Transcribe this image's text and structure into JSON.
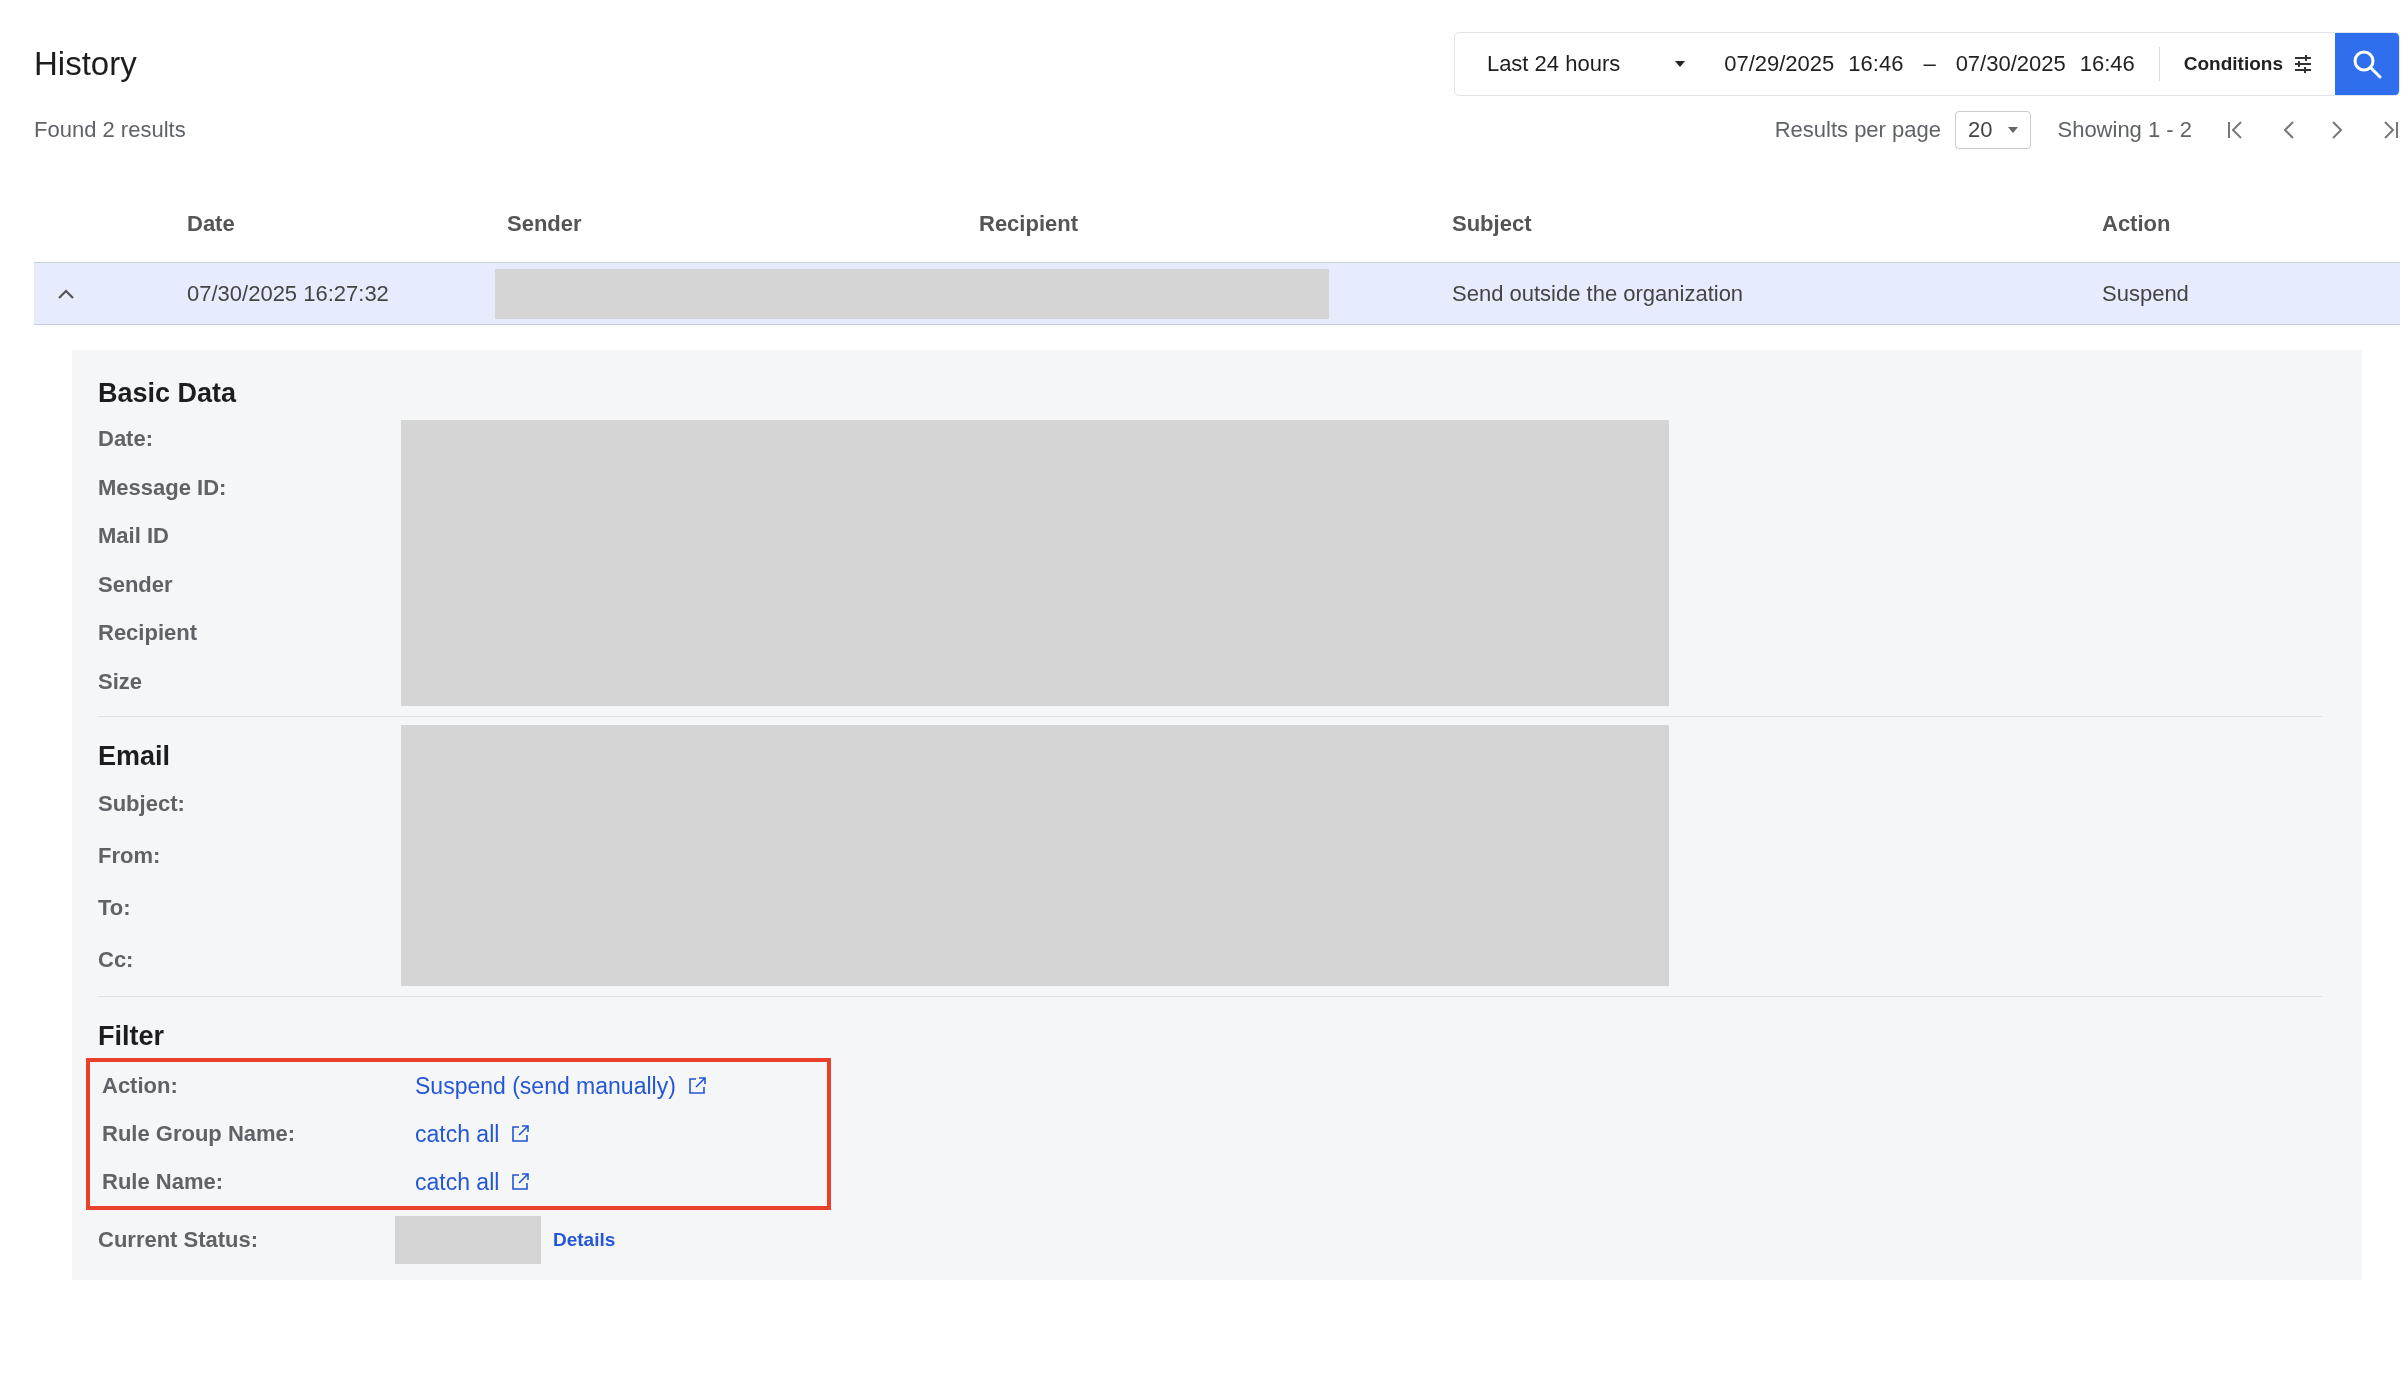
{
  "page": {
    "title": "History"
  },
  "search_bar": {
    "range": "Last 24 hours",
    "from_date": "07/29/2025",
    "from_time": "16:46",
    "separator": "–",
    "to_date": "07/30/2025",
    "to_time": "16:46",
    "conditions": "Conditions"
  },
  "results": {
    "summary": "Found 2 results",
    "per_page_label": "Results per page",
    "per_page": "20",
    "showing": "Showing 1 - 2"
  },
  "table": {
    "columns": [
      "Date",
      "Sender",
      "Recipient",
      "Subject",
      "Action"
    ],
    "rows": [
      {
        "expanded": true,
        "date": "07/30/2025 16:27:32",
        "subject": "Send outside the organization",
        "action": "Suspend"
      }
    ]
  },
  "detail": {
    "sections": [
      {
        "title": "Basic Data",
        "labels": [
          "Date:",
          "Message ID:",
          "Mail ID",
          "Sender",
          "Recipient",
          "Size"
        ]
      },
      {
        "title": "Email",
        "labels": [
          "Subject:",
          "From:",
          "To:",
          "Cc:"
        ]
      }
    ],
    "filter": {
      "title": "Filter",
      "highlighted": true,
      "rows": [
        {
          "label": "Action:",
          "value": "Suspend (send manually)"
        },
        {
          "label": "Rule Group Name:",
          "value": "catch all"
        },
        {
          "label": "Rule Name:",
          "value": "catch all"
        }
      ],
      "status": {
        "label": "Current Status:",
        "link": "Details"
      }
    }
  }
}
